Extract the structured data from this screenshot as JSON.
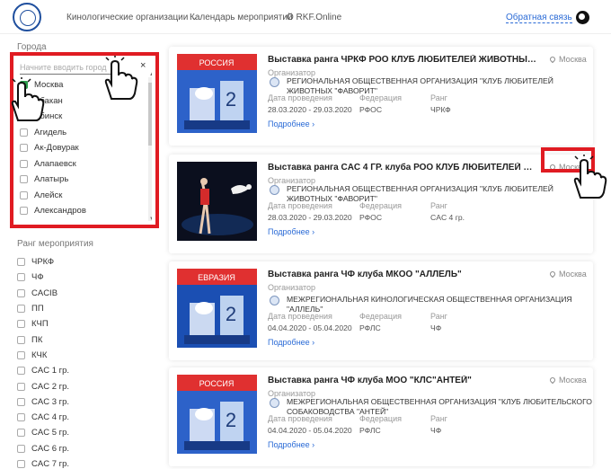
{
  "header": {
    "nav": [
      "Кинологические организации",
      "Календарь мероприятий",
      "О RKF.Online"
    ],
    "feedback": "Обратная связь"
  },
  "sidebar": {
    "city_label": "Города",
    "search_placeholder": "Начните вводить город",
    "clear": "×",
    "cities": [
      {
        "name": "Москва",
        "checked": true
      },
      {
        "name": "Абакан",
        "checked": false
      },
      {
        "name": "Абинск",
        "checked": false
      },
      {
        "name": "Агидель",
        "checked": false
      },
      {
        "name": "Ак-Довурак",
        "checked": false
      },
      {
        "name": "Алапаевск",
        "checked": false
      },
      {
        "name": "Алатырь",
        "checked": false
      },
      {
        "name": "Алейск",
        "checked": false
      },
      {
        "name": "Александров",
        "checked": false
      }
    ],
    "rank_label": "Ранг мероприятия",
    "ranks": [
      "ЧРКФ",
      "ЧФ",
      "CACIB",
      "ПП",
      "КЧП",
      "ПК",
      "КЧК",
      "CAC 1 гр.",
      "CAC 2 гр.",
      "CAC 3 гр.",
      "CAC 4 гр.",
      "CAC 5 гр.",
      "CAC 6 гр.",
      "CAC 7 гр."
    ]
  },
  "labels": {
    "organizer": "Организатор",
    "date": "Дата проведения",
    "federation": "Федерация",
    "rank": "Ранг",
    "more": "Подробнее ›"
  },
  "events": [
    {
      "title": "Выставка ранга ЧРКФ РОО КЛУБ ЛЮБИТЕЛЕЙ ЖИВОТНЫХ \"...",
      "city": "Москва",
      "organizer": "РЕГИОНАЛЬНАЯ ОБЩЕСТВЕННАЯ ОРГАНИЗАЦИЯ \"КЛУБ ЛЮБИТЕЛЕЙ ЖИВОТНЫХ \"ФАВОРИТ\"",
      "date": "28.03.2020 - 29.03.2020",
      "federation": "РФОС",
      "rank": "ЧРКФ"
    },
    {
      "title": "Выставка ранга CAC 4 ГР. клуба РОО КЛУБ ЛЮБИТЕЛЕЙ ЖИВОТН...",
      "city": "Москва",
      "organizer": "РЕГИОНАЛЬНАЯ ОБЩЕСТВЕННАЯ ОРГАНИЗАЦИЯ \"КЛУБ ЛЮБИТЕЛЕЙ ЖИВОТНЫХ \"ФАВОРИТ\"",
      "date": "28.03.2020 - 29.03.2020",
      "federation": "РФОС",
      "rank": "CAC 4 гр."
    },
    {
      "title": "Выставка ранга ЧФ клуба МКОО \"АЛЛЕЛЬ\"",
      "city": "Москва",
      "organizer": "МЕЖРЕГИОНАЛЬНАЯ КИНОЛОГИЧЕСКАЯ ОБЩЕСТВЕННАЯ ОРГАНИЗАЦИЯ \"АЛЛЕЛЬ\"",
      "date": "04.04.2020 - 05.04.2020",
      "federation": "РФЛС",
      "rank": "ЧФ"
    },
    {
      "title": "Выставка ранга ЧФ клуба МОО \"КЛС\"АНТЕЙ\"",
      "city": "Москва",
      "organizer": "МЕЖРЕГИОНАЛЬНАЯ ОБЩЕСТВЕННАЯ ОРГАНИЗАЦИЯ \"КЛУБ ЛЮБИТЕЛЬСКОГО СОБАКОВОДСТВА \"АНТЕЙ\"",
      "date": "04.04.2020 - 05.04.2020",
      "federation": "РФЛС",
      "rank": "ЧФ"
    }
  ],
  "thumb_text": {
    "ru": "РОССИЯ",
    "eu": "ЕВРАЗИЯ"
  },
  "colors": {
    "accent": "#2b6bd6",
    "highlight": "#e01b22",
    "checked": "#2a9d4a"
  }
}
